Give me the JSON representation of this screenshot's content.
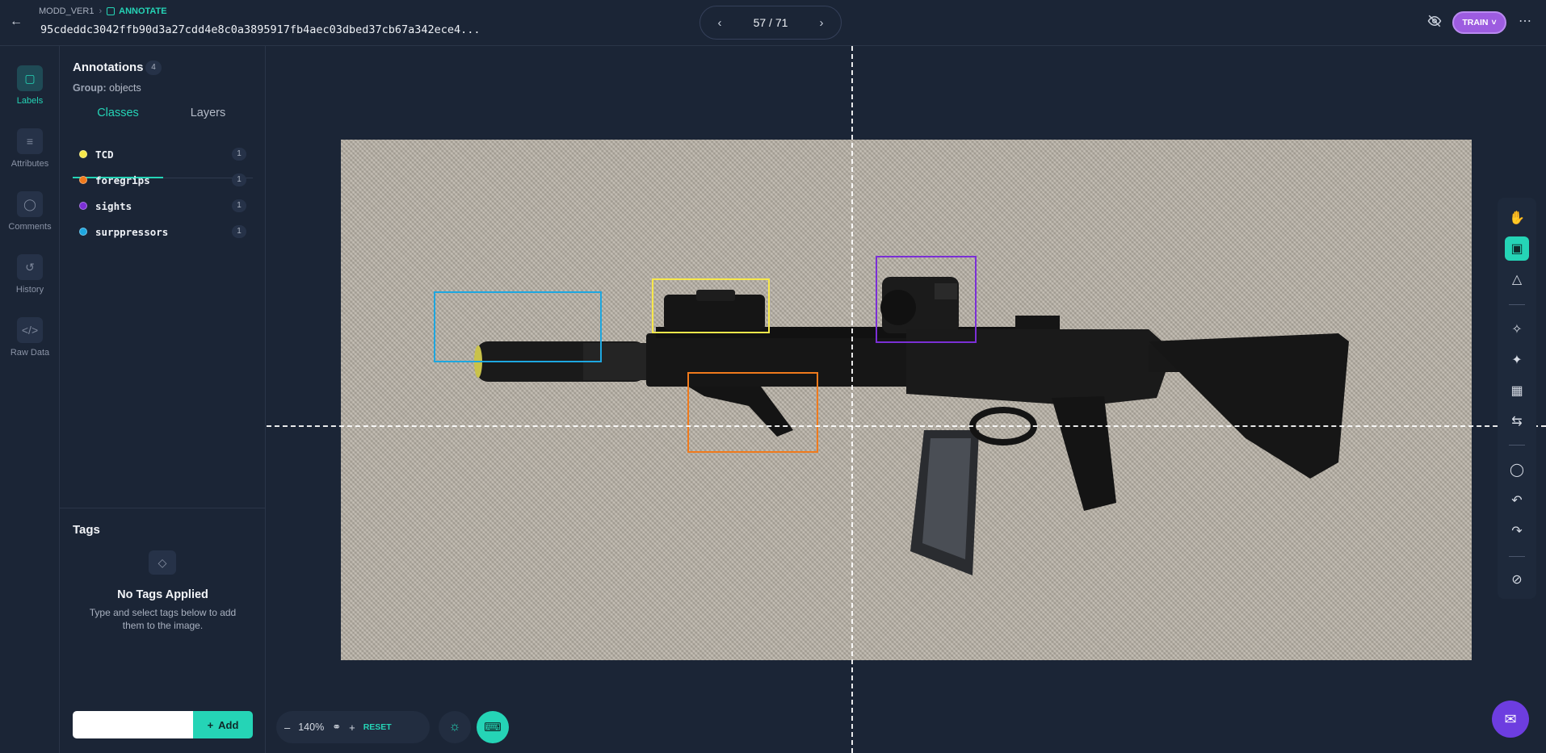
{
  "header": {
    "project": "MODD_VER1",
    "mode": "ANNOTATE",
    "filename": "95cdeddc3042ffb90d3a27cdd4e8c0a3895917fb4aec03dbed37cb67a342ece4...",
    "pager": "57 / 71",
    "train_label": "TRAIN"
  },
  "rail": {
    "labels": "Labels",
    "attributes": "Attributes",
    "comments": "Comments",
    "history": "History",
    "raw_data": "Raw Data"
  },
  "annotations": {
    "title": "Annotations",
    "count": "4",
    "group_label": "Group:",
    "group_value": "objects",
    "tabs": [
      "Classes",
      "Layers"
    ],
    "classes": [
      {
        "name": "TCD",
        "count": "1",
        "color": "#f7e84a"
      },
      {
        "name": "foregrips",
        "count": "1",
        "color": "#f07a1c"
      },
      {
        "name": "sights",
        "count": "1",
        "color": "#7b2fd6"
      },
      {
        "name": "surppressors",
        "count": "1",
        "color": "#1ea7e0"
      }
    ]
  },
  "tags": {
    "title": "Tags",
    "empty_title": "No Tags Applied",
    "empty_help": "Type and select tags below to add them to the image.",
    "input_value": "",
    "add_label": "Add"
  },
  "zoom": {
    "level": "140%",
    "reset_label": "RESET"
  },
  "colors": {
    "accent": "#25d4b6",
    "train": "#9d5ce0"
  }
}
